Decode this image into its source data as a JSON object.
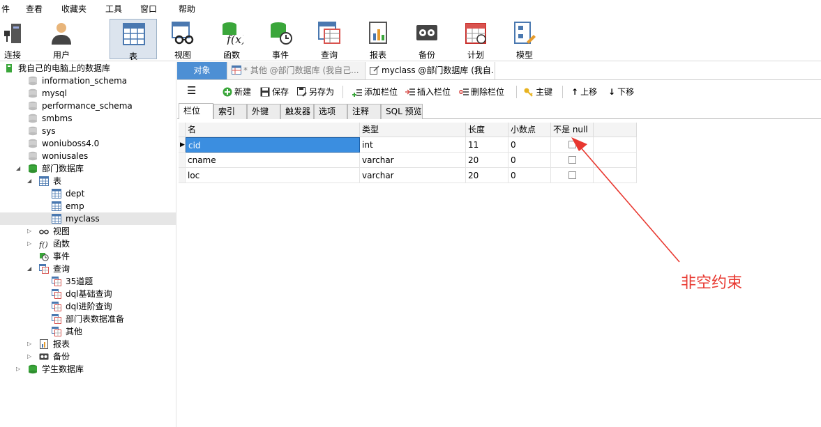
{
  "menu": [
    "件",
    "查看",
    "收藏夹",
    "工具",
    "窗口",
    "帮助"
  ],
  "toolbar": [
    {
      "label": "连接",
      "icon": "connection-icon"
    },
    {
      "label": "用户",
      "icon": "user-icon"
    },
    {
      "label": "表",
      "icon": "table-icon",
      "active": true
    },
    {
      "label": "视图",
      "icon": "view-icon"
    },
    {
      "label": "函数",
      "icon": "function-icon"
    },
    {
      "label": "事件",
      "icon": "event-icon"
    },
    {
      "label": "查询",
      "icon": "query-icon"
    },
    {
      "label": "报表",
      "icon": "report-icon"
    },
    {
      "label": "备份",
      "icon": "backup-icon"
    },
    {
      "label": "计划",
      "icon": "schedule-icon"
    },
    {
      "label": "模型",
      "icon": "model-icon"
    }
  ],
  "tree": [
    {
      "label": "我自己的电脑上的数据库",
      "level": 0,
      "icon": "connection-icon",
      "arrow": ""
    },
    {
      "label": "information_schema",
      "level": 1,
      "icon": "database-gray-icon",
      "arrow": ""
    },
    {
      "label": "mysql",
      "level": 1,
      "icon": "database-gray-icon",
      "arrow": ""
    },
    {
      "label": "performance_schema",
      "level": 1,
      "icon": "database-gray-icon",
      "arrow": ""
    },
    {
      "label": "smbms",
      "level": 1,
      "icon": "database-gray-icon",
      "arrow": ""
    },
    {
      "label": "sys",
      "level": 1,
      "icon": "database-gray-icon",
      "arrow": ""
    },
    {
      "label": "woniuboss4.0",
      "level": 1,
      "icon": "database-gray-icon",
      "arrow": ""
    },
    {
      "label": "woniusales",
      "level": 1,
      "icon": "database-gray-icon",
      "arrow": ""
    },
    {
      "label": "部门数据库",
      "level": 1,
      "icon": "database-green-icon",
      "arrow": "open"
    },
    {
      "label": "表",
      "level": 2,
      "icon": "table-icon",
      "arrow": "open"
    },
    {
      "label": "dept",
      "level": 3,
      "icon": "table-icon",
      "arrow": ""
    },
    {
      "label": "emp",
      "level": 3,
      "icon": "table-icon",
      "arrow": ""
    },
    {
      "label": "myclass",
      "level": 3,
      "icon": "table-icon",
      "arrow": "",
      "selected": true
    },
    {
      "label": "视图",
      "level": 2,
      "icon": "view-icon",
      "arrow": "closed"
    },
    {
      "label": "函数",
      "level": 2,
      "icon": "function-icon",
      "arrow": "closed"
    },
    {
      "label": "事件",
      "level": 2,
      "icon": "event-icon",
      "arrow": ""
    },
    {
      "label": "查询",
      "level": 2,
      "icon": "query-icon",
      "arrow": "open"
    },
    {
      "label": "35道题",
      "level": 3,
      "icon": "query-icon",
      "arrow": ""
    },
    {
      "label": "dql基础查询",
      "level": 3,
      "icon": "query-icon",
      "arrow": ""
    },
    {
      "label": "dql进阶查询",
      "level": 3,
      "icon": "query-icon",
      "arrow": ""
    },
    {
      "label": "部门表数据准备",
      "level": 3,
      "icon": "query-icon",
      "arrow": ""
    },
    {
      "label": "其他",
      "level": 3,
      "icon": "query-icon",
      "arrow": ""
    },
    {
      "label": "报表",
      "level": 2,
      "icon": "report-icon",
      "arrow": "closed"
    },
    {
      "label": "备份",
      "level": 2,
      "icon": "backup-icon",
      "arrow": "closed"
    },
    {
      "label": "学生数据库",
      "level": 1,
      "icon": "database-green-icon",
      "arrow": "closed"
    }
  ],
  "doc_tabs": {
    "objects": "对象",
    "others": "* 其他 @部门数据库 (我自己...",
    "myclass": "myclass @部门数据库 (我自..."
  },
  "editor_toolbar": {
    "new": "新建",
    "save": "保存",
    "save_as": "另存为",
    "add_field": "添加栏位",
    "insert_field": "插入栏位",
    "delete_field": "删除栏位",
    "primary_key": "主键",
    "move_up": "上移",
    "move_down": "下移"
  },
  "sub_tabs": [
    "栏位",
    "索引",
    "外键",
    "触发器",
    "选项",
    "注释",
    "SQL 预览"
  ],
  "grid": {
    "headers": [
      "名",
      "类型",
      "长度",
      "小数点",
      "不是 null"
    ],
    "rows": [
      {
        "name": "cid",
        "type": "int",
        "length": "11",
        "decimals": "0",
        "not_null": false,
        "current": true
      },
      {
        "name": "cname",
        "type": "varchar",
        "length": "20",
        "decimals": "0",
        "not_null": false
      },
      {
        "name": "loc",
        "type": "varchar",
        "length": "20",
        "decimals": "0",
        "not_null": false
      }
    ]
  },
  "annotation": "非空约束",
  "colors": {
    "accent": "#4d8fd4",
    "highlight": "#3b8ee0",
    "annotation": "#e8372f",
    "db_green": "#3aa63a"
  }
}
